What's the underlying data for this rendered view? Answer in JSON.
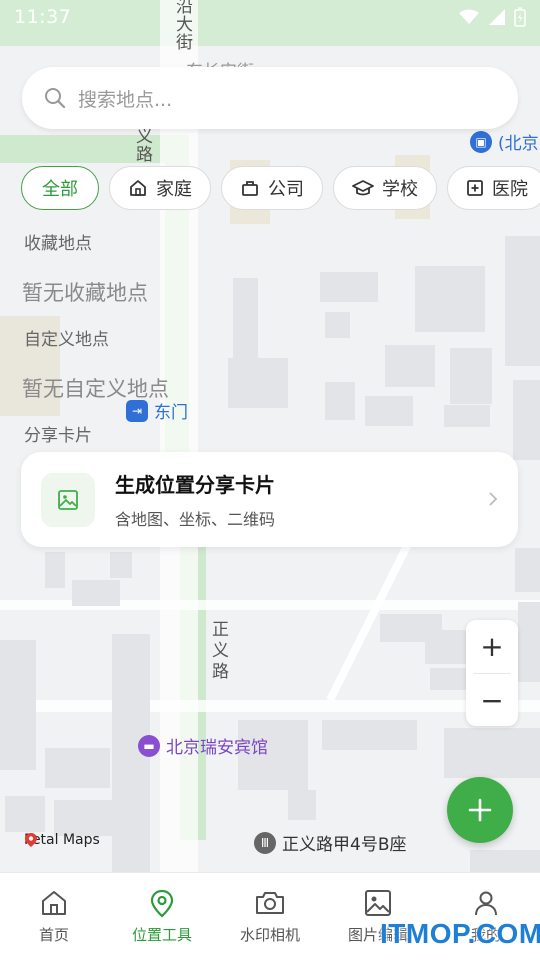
{
  "status_bar": {
    "time": "11:37"
  },
  "search": {
    "placeholder": "搜索地点..."
  },
  "chips": [
    {
      "label": "全部",
      "icon": "none",
      "active": true
    },
    {
      "label": "家庭",
      "icon": "home-icon"
    },
    {
      "label": "公司",
      "icon": "briefcase-icon"
    },
    {
      "label": "学校",
      "icon": "graduation-cap-icon"
    },
    {
      "label": "医院",
      "icon": "hospital-icon"
    }
  ],
  "sections": {
    "favorites_label": "收藏地点",
    "favorites_empty": "暂无收藏地点",
    "custom_label": "自定义地点",
    "custom_empty": "暂无自定义地点",
    "share_label": "分享卡片"
  },
  "share_card": {
    "title": "生成位置分享卡片",
    "subtitle": "含地图、坐标、二维码"
  },
  "map": {
    "street_labels": {
      "yanda_jie": "沿\n大\n街",
      "east_chang_an": "东长安街",
      "yi_lu": "义\n路",
      "zhengyi_lu": "正\n义\n路"
    },
    "pois": {
      "beijing_station": "(北京",
      "dongmen": "东门",
      "hotel": "北京瑞安宾馆",
      "address": "正义路甲4号B座"
    },
    "attribution": "Petal Maps",
    "colors": {
      "green_belt": "#cde9cd",
      "road": "#ffffff",
      "building": "#e3e4e7",
      "poi_purple": "#8a4fd1",
      "poi_blue": "#2f6fd6"
    }
  },
  "zoom": {
    "in_label": "+",
    "out_label": "−"
  },
  "bottom_nav": [
    {
      "label": "首页",
      "icon": "home-icon"
    },
    {
      "label": "位置工具",
      "icon": "location-pin-icon",
      "active": true
    },
    {
      "label": "水印相机",
      "icon": "camera-icon"
    },
    {
      "label": "图片编辑",
      "icon": "image-icon"
    },
    {
      "label": "我的",
      "icon": "user-icon"
    }
  ],
  "watermark": "ITMOP.COM",
  "accent_color": "#3fae49"
}
